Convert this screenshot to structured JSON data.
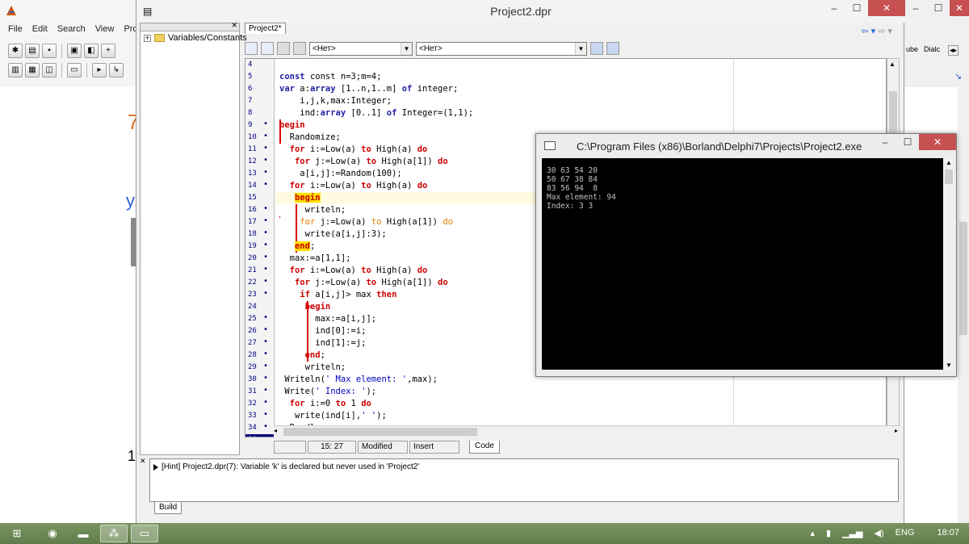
{
  "delphi_main": {
    "menu": [
      "File",
      "Edit",
      "Search",
      "View",
      "Pro"
    ],
    "right_labels": [
      "ube",
      "Dialc"
    ]
  },
  "editor_window": {
    "title": "Project2.dpr",
    "tree_item": "Variables/Constants",
    "tab": "Project2*",
    "combo1": "<Нет>",
    "combo2": "<Нет>"
  },
  "code": {
    "lines": [
      {
        "n": "4",
        "dot": false
      },
      {
        "n": "5",
        "dot": false
      },
      {
        "n": "6",
        "dot": false
      },
      {
        "n": "7",
        "dot": false
      },
      {
        "n": "8",
        "dot": false
      },
      {
        "n": "9",
        "dot": true
      },
      {
        "n": "10",
        "dot": true
      },
      {
        "n": "11",
        "dot": true
      },
      {
        "n": "12",
        "dot": true
      },
      {
        "n": "13",
        "dot": true
      },
      {
        "n": "14",
        "dot": true
      },
      {
        "n": "15",
        "dot": false
      },
      {
        "n": "16",
        "dot": true
      },
      {
        "n": "17",
        "dot": true
      },
      {
        "n": "18",
        "dot": true
      },
      {
        "n": "19",
        "dot": true
      },
      {
        "n": "20",
        "dot": true
      },
      {
        "n": "21",
        "dot": true
      },
      {
        "n": "22",
        "dot": true
      },
      {
        "n": "23",
        "dot": true
      },
      {
        "n": "24",
        "dot": false
      },
      {
        "n": "25",
        "dot": true
      },
      {
        "n": "26",
        "dot": true
      },
      {
        "n": "27",
        "dot": true
      },
      {
        "n": "28",
        "dot": true
      },
      {
        "n": "29",
        "dot": true
      },
      {
        "n": "30",
        "dot": true
      },
      {
        "n": "31",
        "dot": true
      },
      {
        "n": "32",
        "dot": true
      },
      {
        "n": "33",
        "dot": true
      },
      {
        "n": "34",
        "dot": true
      },
      {
        "n": "36",
        "dot": true
      }
    ],
    "text": {
      "l5": "const n=3;m=4;",
      "l6a": "var",
      "l6b": " a:",
      "l6c": "array",
      "l6d": " [1..n,1..m] ",
      "l6e": "of",
      "l6f": " integer;",
      "l7": "    i,j,k,max:Integer;",
      "l8a": "    ind:",
      "l8b": "array",
      "l8c": " [0..1] ",
      "l8d": "of",
      "l8e": " Integer=(1,1);",
      "l9": "begin",
      "l10": "  Randomize;",
      "l11a": "  ",
      "l11b": "for",
      "l11c": " i:=Low(a) ",
      "l11d": "to",
      "l11e": " High(a) ",
      "l11f": "do",
      "l12a": "   ",
      "l12b": "for",
      "l12c": " j:=Low(a) ",
      "l12d": "to",
      "l12e": " High(a[1]) ",
      "l12f": "do",
      "l13": "    a[i,j]:=Random(100);",
      "l14a": "  ",
      "l14b": "for",
      "l14c": " i:=Low(a) ",
      "l14d": "to",
      "l14e": " High(a) ",
      "l14f": "do",
      "l15": "begin",
      "l16": "     writeln;",
      "l17a": "    ",
      "l17b": "for",
      "l17c": " j:=Low(a) ",
      "l17d": "to",
      "l17e": " High(a[1]) ",
      "l17f": "do",
      "l18": "     write(a[i,j]:3);",
      "l19": "end",
      "l20": "  max:=a[1,1];",
      "l21a": "  ",
      "l21b": "for",
      "l21c": " i:=Low(a) ",
      "l21d": "to",
      "l21e": " High(a) ",
      "l21f": "do",
      "l22a": "   ",
      "l22b": "for",
      "l22c": " j:=Low(a) ",
      "l22d": "to",
      "l22e": " High(a[1]) ",
      "l22f": "do",
      "l23a": "    ",
      "l23b": "if",
      "l23c": " a[i,j]> max ",
      "l23d": "then",
      "l24": "begin",
      "l25": "       max:=a[i,j];",
      "l26": "       ind[0]:=i;",
      "l27": "       ind[1]:=j;",
      "l28": "end",
      "l29": "     writeln;",
      "l30a": " Writeln(",
      "l30b": "' Max element: '",
      "l30c": ",max);",
      "l31a": " Write(",
      "l31b": "' Index: '",
      "l31c": ");",
      "l32a": "  ",
      "l32b": "for",
      "l32c": " i:=0 ",
      "l32d": "to",
      "l32e": " 1 ",
      "l32f": "do",
      "l33a": "   write(ind[i],",
      "l33b": "' '",
      "l33c": ");",
      "l34": "  Readln;"
    }
  },
  "status": {
    "position": "15: 27",
    "modified": "Modified",
    "mode": "Insert",
    "code_tab": "Code"
  },
  "messages": {
    "hint": "[Hint] Project2.dpr(7): Variable 'k' is declared but never used in 'Project2'",
    "build_tab": "Build"
  },
  "console": {
    "title": "C:\\Program Files (x86)\\Borland\\Delphi7\\Projects\\Project2.exe",
    "lines": [
      "30 63 54 20",
      "50 67 38 84",
      "83 56 94  8",
      "Max element: 94",
      "Index: 3 3"
    ]
  },
  "taskbar": {
    "language": "ENG",
    "time": "18:07"
  },
  "colors": {
    "keyword": "#1f1fa0",
    "keyword_red": "#cc0000",
    "begin_end_highlight": "#ffe000",
    "console_bg": "#000000",
    "console_text": "#c0c0c0",
    "close_button": "#c75050"
  }
}
